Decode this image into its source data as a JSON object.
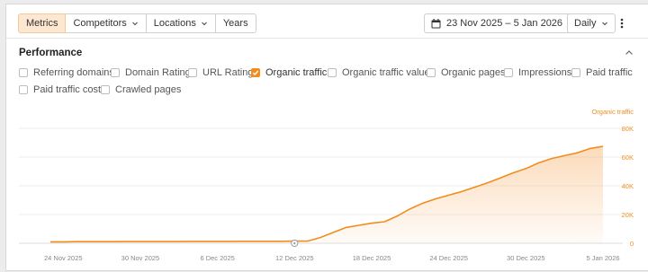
{
  "toolbar": {
    "tabs": [
      {
        "label": "Metrics",
        "active": true,
        "dropdown": false
      },
      {
        "label": "Competitors",
        "active": false,
        "dropdown": true
      },
      {
        "label": "Locations",
        "active": false,
        "dropdown": true
      },
      {
        "label": "Years",
        "active": false,
        "dropdown": false
      }
    ],
    "date_range": "23 Nov 2025 – 5 Jan 2026",
    "interval": "Daily"
  },
  "performance": {
    "title": "Performance",
    "metrics": [
      {
        "label": "Referring domains",
        "checked": false
      },
      {
        "label": "Domain Rating",
        "checked": false
      },
      {
        "label": "URL Rating",
        "checked": false
      },
      {
        "label": "Organic traffic",
        "checked": true
      },
      {
        "label": "Organic traffic value",
        "checked": false
      },
      {
        "label": "Organic pages",
        "checked": false
      },
      {
        "label": "Impressions",
        "checked": false
      },
      {
        "label": "Paid traffic",
        "checked": false
      },
      {
        "label": "Paid traffic cost",
        "checked": false
      },
      {
        "label": "Crawled pages",
        "checked": false
      }
    ]
  },
  "colors": {
    "accent": "#f28c1e",
    "active_tab_bg": "#fde7d1"
  },
  "chart_data": {
    "type": "area",
    "title": "",
    "series_label": "Organic traffic",
    "xlabel": "",
    "ylabel": "Organic traffic",
    "x_ticks": [
      "24 Nov 2025",
      "30 Nov 2025",
      "6 Dec 2025",
      "12 Dec 2025",
      "18 Dec 2025",
      "24 Dec 2025",
      "30 Dec 2025",
      "5 Jan 2026"
    ],
    "y_ticks": [
      "0",
      "20K",
      "40K",
      "60K",
      "80K"
    ],
    "ylim": [
      0,
      80000
    ],
    "y_axis_position": "right",
    "grid": true,
    "series": [
      {
        "name": "Organic traffic",
        "x": [
          "23 Nov 2025",
          "24 Nov 2025",
          "25 Nov 2025",
          "26 Nov 2025",
          "27 Nov 2025",
          "28 Nov 2025",
          "29 Nov 2025",
          "30 Nov 2025",
          "1 Dec 2025",
          "2 Dec 2025",
          "3 Dec 2025",
          "4 Dec 2025",
          "5 Dec 2025",
          "6 Dec 2025",
          "7 Dec 2025",
          "8 Dec 2025",
          "9 Dec 2025",
          "10 Dec 2025",
          "11 Dec 2025",
          "12 Dec 2025",
          "13 Dec 2025",
          "14 Dec 2025",
          "15 Dec 2025",
          "16 Dec 2025",
          "17 Dec 2025",
          "18 Dec 2025",
          "19 Dec 2025",
          "20 Dec 2025",
          "21 Dec 2025",
          "22 Dec 2025",
          "23 Dec 2025",
          "24 Dec 2025",
          "25 Dec 2025",
          "26 Dec 2025",
          "27 Dec 2025",
          "28 Dec 2025",
          "29 Dec 2025",
          "30 Dec 2025",
          "31 Dec 2025",
          "1 Jan 2026",
          "2 Jan 2026",
          "3 Jan 2026",
          "4 Jan 2026",
          "5 Jan 2026"
        ],
        "values": [
          1000,
          1000,
          1100,
          1100,
          1100,
          1100,
          1200,
          1200,
          1200,
          1200,
          1200,
          1300,
          1300,
          1300,
          1300,
          1400,
          1400,
          1400,
          1400,
          1500,
          1500,
          4000,
          7500,
          11000,
          12500,
          14000,
          15000,
          19000,
          24000,
          28000,
          31000,
          33500,
          36000,
          39000,
          42000,
          45500,
          49000,
          52000,
          56000,
          59000,
          61000,
          63000,
          66000,
          67500
        ]
      }
    ],
    "marker": {
      "x": "12 Dec 2025",
      "icon": "annotation-marker"
    }
  }
}
